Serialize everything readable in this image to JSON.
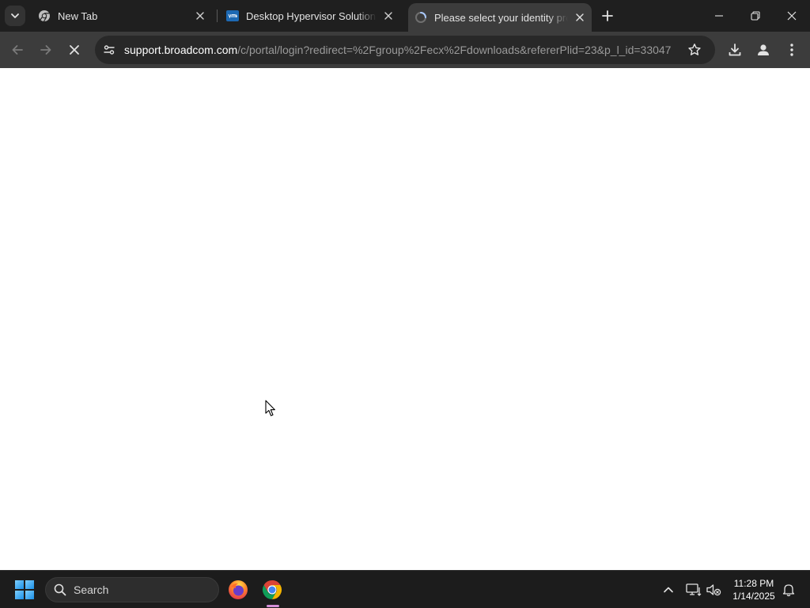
{
  "browser": {
    "tabs": [
      {
        "title": "New Tab",
        "favicon": "chrome-icon",
        "active": false
      },
      {
        "title": "Desktop Hypervisor Solutions |",
        "favicon": "vmware-icon",
        "active": false
      },
      {
        "title": "Please select your identity prov",
        "favicon": "loading-icon",
        "active": true
      }
    ],
    "toolbar": {
      "url_host": "support.broadcom.com",
      "url_path": "/c/portal/login?redirect=%2Fgroup%2Fecx%2Fdownloads&refererPlid=23&p_l_id=33047"
    }
  },
  "taskbar": {
    "search_label": "Search",
    "apps": [
      "firefox-icon",
      "chrome-icon"
    ],
    "clock": {
      "time": "11:28 PM",
      "date": "1/14/2025"
    }
  },
  "colors": {
    "tabstrip": "#1f1f1f",
    "toolbar": "#3c3c3c",
    "omnibox": "#282828",
    "taskbar": "#1c1c1c",
    "vmware_brand": "#1d69b3",
    "page_background": "#ffffff"
  }
}
